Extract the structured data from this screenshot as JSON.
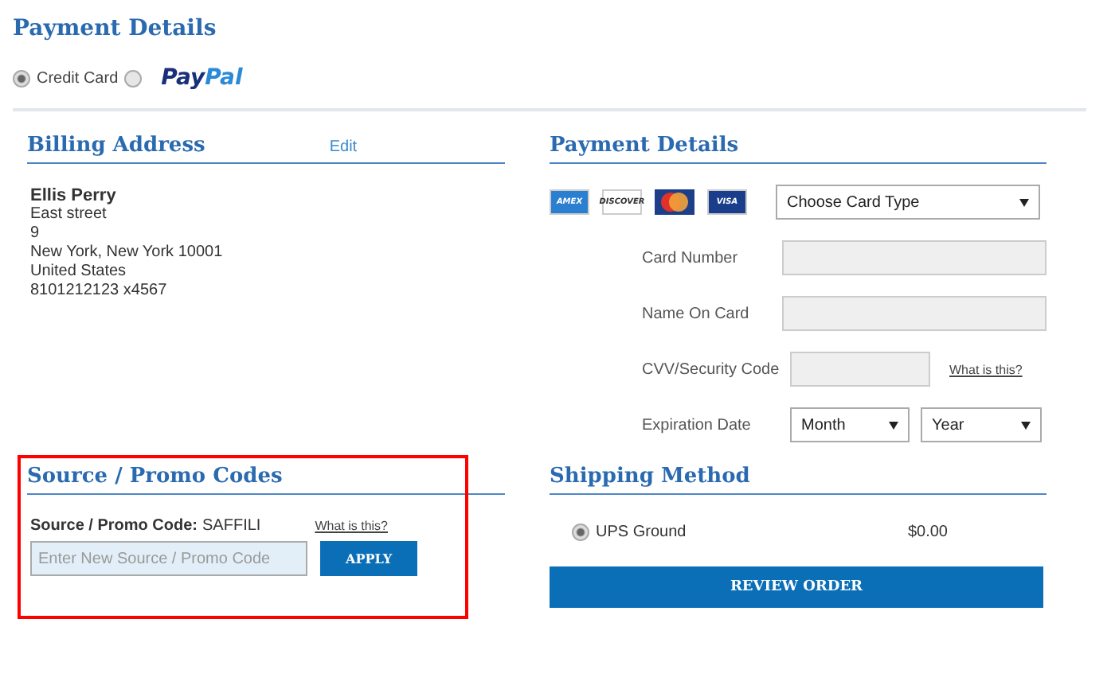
{
  "title": "Payment Details",
  "payment_methods": [
    {
      "kind": "text",
      "label": "Credit Card",
      "selected": true
    },
    {
      "kind": "paypal",
      "label_parts": [
        "Pay",
        "Pal"
      ],
      "selected": false
    }
  ],
  "billing": {
    "heading": "Billing Address",
    "edit": "Edit",
    "name": "Ellis Perry",
    "lines": [
      "East street",
      "9",
      "New York, New York 10001",
      "United States",
      "8101212123 x4567"
    ]
  },
  "payment": {
    "heading": "Payment Details",
    "cards": [
      {
        "kind": "amex",
        "label": "AMEX"
      },
      {
        "kind": "discover",
        "label": "DISCOVER"
      },
      {
        "kind": "mastercard"
      },
      {
        "kind": "visa",
        "label": "VISA"
      }
    ],
    "card_type": "Choose Card Type",
    "fields": [
      {
        "kind": "input",
        "label": "Card Number"
      },
      {
        "kind": "input",
        "label": "Name On Card"
      },
      {
        "kind": "cvv",
        "label": "CVV/Security Code",
        "help": "What is this?"
      },
      {
        "kind": "date",
        "label": "Expiration Date",
        "month": "Month",
        "year": "Year"
      }
    ]
  },
  "promo": {
    "heading": "Source / Promo Codes",
    "highlighted": true,
    "current_label": "Source / Promo Code:",
    "current_value": "SAFFILI",
    "help": "What is this?",
    "placeholder": "Enter New Source / Promo Code",
    "button": "APPLY"
  },
  "shipping": {
    "heading": "Shipping Method",
    "options": [
      {
        "label": "UPS Ground",
        "price": "$0.00",
        "selected": true
      }
    ],
    "button": "REVIEW ORDER"
  }
}
